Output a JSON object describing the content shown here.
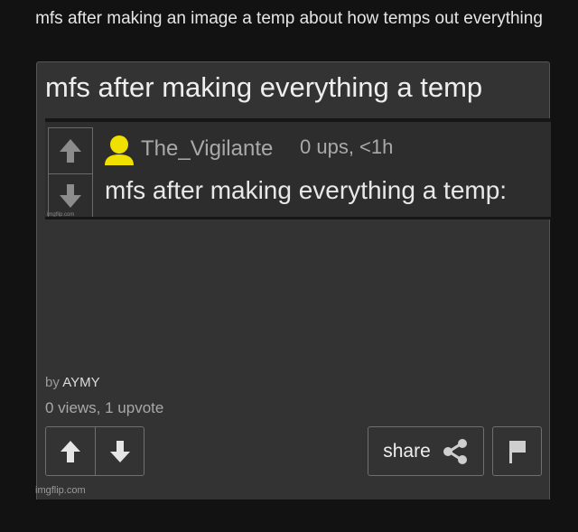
{
  "caption": "mfs after making an image a temp about how temps out everything",
  "post": {
    "title": "mfs after making everything a temp",
    "comment_image": {
      "username": "The_Vigilante",
      "meta": "0 ups, <1h",
      "text": "mfs after making everything a temp:",
      "watermark": "imgflip.com"
    },
    "by_prefix": "by",
    "author": "AYMY",
    "stats": "0 views, 1 upvote",
    "share_label": "share",
    "icons": [
      "upvote-arrow-icon",
      "downvote-arrow-icon",
      "share-icon",
      "flag-icon",
      "avatar-icon"
    ]
  },
  "watermark": "imgflip.com",
  "colors": {
    "background": "#121212",
    "card": "#333333",
    "avatar": "#f0e000"
  }
}
